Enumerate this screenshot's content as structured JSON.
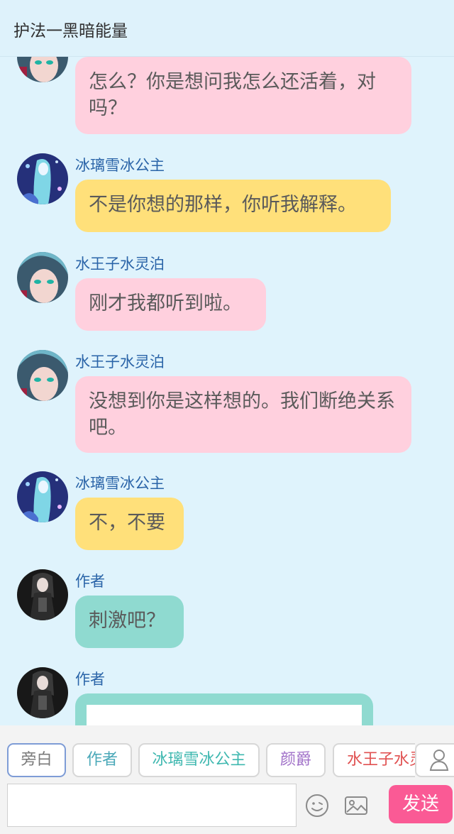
{
  "header": {
    "title": "护法一黑暗能量"
  },
  "messages": [
    {
      "sender": "",
      "text": "怎么？你是想问我怎么还活着，对吗？"
    },
    {
      "sender": "冰璃雪冰公主",
      "text": "不是你想的那样，你听我解释。"
    },
    {
      "sender": "水王子水灵泊",
      "text": "刚才我都听到啦。"
    },
    {
      "sender": "水王子水灵泊",
      "text": "没想到你是这样想的。我们断绝关系吧。"
    },
    {
      "sender": "冰璃雪冰公主",
      "text": "不，不要"
    },
    {
      "sender": "作者",
      "text": "刺激吧？"
    },
    {
      "sender": "作者",
      "text": ""
    }
  ],
  "footer": {
    "tabs": [
      {
        "label": "旁白",
        "color": "#7a7a7a"
      },
      {
        "label": "作者",
        "color": "#4aa8b8"
      },
      {
        "label": "冰璃雪冰公主",
        "color": "#3fb8b0"
      },
      {
        "label": "颜爵",
        "color": "#a070c8"
      },
      {
        "label": "水王子水灵泊",
        "color": "#e05050"
      }
    ],
    "input_placeholder": "",
    "send_label": "发送",
    "icons": [
      "emoji-icon",
      "image-icon",
      "user-icon"
    ]
  },
  "colors": {
    "background": "#dff3fc",
    "bubble_pink": "#ffd0de",
    "bubble_yellow": "#ffe07a",
    "bubble_teal": "#8fdad0",
    "name_blue": "#2a64a8",
    "send_pink": "#fa5a95"
  }
}
